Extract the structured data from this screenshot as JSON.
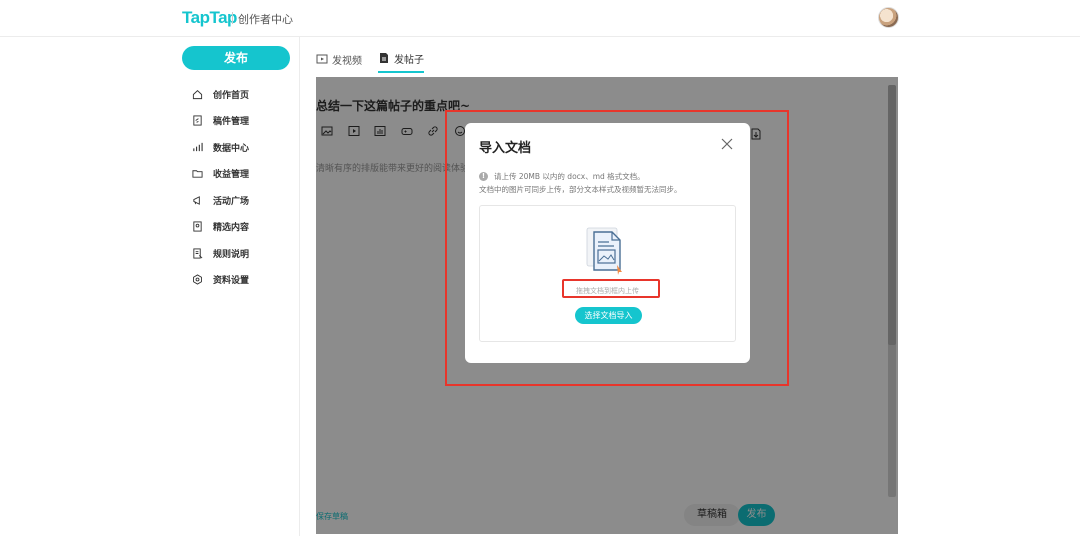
{
  "header": {
    "logo": "TapTap",
    "subtitle": "创作者中心",
    "avatar_icon": "user-avatar"
  },
  "sidebar": {
    "publish_label": "发布",
    "items": [
      {
        "label": "创作首页",
        "icon": "home-icon"
      },
      {
        "label": "稿件管理",
        "icon": "document-edit-icon"
      },
      {
        "label": "数据中心",
        "icon": "bar-chart-icon"
      },
      {
        "label": "收益管理",
        "icon": "folder-icon"
      },
      {
        "label": "活动广场",
        "icon": "megaphone-icon"
      },
      {
        "label": "精选内容",
        "icon": "bookmark-icon"
      },
      {
        "label": "规则说明",
        "icon": "rules-icon"
      },
      {
        "label": "资料设置",
        "icon": "settings-icon"
      }
    ]
  },
  "tabs": [
    {
      "label": "发视频",
      "icon": "video-icon",
      "active": false
    },
    {
      "label": "发帖子",
      "icon": "post-icon",
      "active": true
    }
  ],
  "editor": {
    "title_placeholder": "总结一下这篇帖子的重点吧~",
    "body_placeholder": "清晰有序的排版能带来更好的阅读体验",
    "save_draft": "保存草稿",
    "drafts_label": "草稿箱",
    "publish_label": "发布"
  },
  "modal": {
    "title": "导入文档",
    "hint_line1": "请上传 20MB 以内的 docx、md 格式文档。",
    "hint_line2": "文档中的图片可同步上传，部分文本样式及视频暂无法同步。",
    "drag_text": "拖拽文档到框内上传",
    "choose_label": "选择文档导入"
  },
  "colors": {
    "accent": "#15c5ce",
    "annotation": "#e8352b"
  }
}
